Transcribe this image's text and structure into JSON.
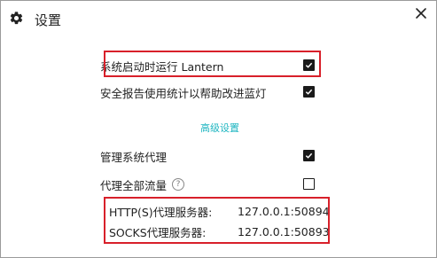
{
  "header": {
    "title": "设置"
  },
  "settings": [
    {
      "label": "系统启动时运行 Lantern",
      "checked": true
    },
    {
      "label": "安全报告使用统计以帮助改进蓝灯",
      "checked": true
    },
    {
      "label": "管理系统代理",
      "checked": true
    },
    {
      "label": "代理全部流量",
      "checked": false
    }
  ],
  "advanced_link": "高级设置",
  "help_icon": "?",
  "proxy": {
    "http_label": "HTTP(S)代理服务器:",
    "http_value": "127.0.0.1:50894",
    "socks_label": "SOCKS代理服务器:",
    "socks_value": "127.0.0.1:50893"
  },
  "colors": {
    "accent": "#1fb6c1",
    "highlight": "#d8202a"
  }
}
